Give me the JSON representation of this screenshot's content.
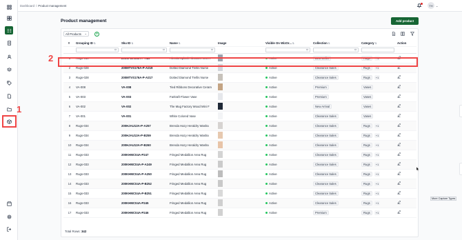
{
  "breadcrumb": {
    "root": "Dashboard",
    "separator": "/",
    "current": "Product management"
  },
  "header": {
    "avatar_initials": "TH",
    "avatar_chevron": "⌄"
  },
  "page": {
    "title": "Product management",
    "add_button": "Add product"
  },
  "toolbar": {
    "filter_value": "All Products",
    "filter_chevron": "⌄",
    "add_view": "+"
  },
  "table": {
    "columns": [
      "#",
      "Grouping ID",
      "Sku ID",
      "Name",
      "Image",
      "Visible On WizOr...",
      "Collection",
      "Category",
      "Action"
    ],
    "sort_glyph": "⇅",
    "filter_glyph": "⛉",
    "rows": [
      {
        "n": "1",
        "group": "Rugs-010",
        "sku": "200CFDRO8A-P-A80",
        "name": "Alessia Splash Abstract Area R",
        "status": "Active",
        "collection": "Best Seller",
        "category": "Rugs",
        "more": "+1",
        "thumb": "#9ca3af"
      },
      {
        "n": "2",
        "group": "Rugs-028",
        "sku": "200MTVS176A-P-A219",
        "name": "Dotted Diamond Trellis Nurse",
        "status": "Active",
        "collection": "Clearance Sales",
        "category": "Rugs",
        "more": "+1",
        "thumb": "#d1d5db"
      },
      {
        "n": "3",
        "group": "Rugs-028",
        "sku": "200MTVS176A-P-A217",
        "name": "Dotted Diamond Trellis Nurse",
        "status": "Active",
        "collection": "Clearance Sales",
        "category": "Rugs",
        "more": "+1",
        "thumb": "#c7c2bb"
      },
      {
        "n": "4",
        "group": "VA-008",
        "sku": "VA-008",
        "name": "Tied Ribbons Decorative Ceram",
        "status": "Active",
        "collection": "Premium",
        "category": "Vases",
        "more": "",
        "thumb": "#c4a484"
      },
      {
        "n": "5",
        "group": "VA-003",
        "sku": "VA-003",
        "name": "Farkraft Flower Vase",
        "status": "Active",
        "collection": "Premium",
        "category": "Vases",
        "more": "",
        "thumb": "#e5e7eb"
      },
      {
        "n": "6",
        "group": "VA-002",
        "sku": "VA-002",
        "name": "The Mug Factory Wood Mini F",
        "status": "Active",
        "collection": "New Arrival",
        "category": "Vases",
        "more": "",
        "thumb": "#1f2937"
      },
      {
        "n": "7",
        "group": "VA-001",
        "sku": "VA-001",
        "name": "White Colored Vase",
        "status": "Active",
        "collection": "Clearance Sales",
        "category": "Vases",
        "more": "",
        "thumb": "#f3f4f6"
      },
      {
        "n": "8",
        "group": "Rugs-034",
        "sku": "200HJAU13A-P-A257",
        "name": "Brenda Hazy Heraldry Washa",
        "status": "Active",
        "collection": "Clearance Sales",
        "category": "Rugs",
        "more": "+1",
        "thumb": "#d6d3d1"
      },
      {
        "n": "9",
        "group": "Rugs-034",
        "sku": "200HJAU13A-P-B259",
        "name": "Brenda Hazy Heraldry Washa",
        "status": "Active",
        "collection": "Clearance Sales",
        "category": "Rugs",
        "more": "+1",
        "thumb": "#e7c9b0"
      },
      {
        "n": "10",
        "group": "Rugs-034",
        "sku": "200HJAU13A-P-B260",
        "name": "Brenda Hazy Heraldry Washa",
        "status": "Active",
        "collection": "Clearance Sales",
        "category": "Rugs",
        "more": "+1",
        "thumb": "#e8c4a8"
      },
      {
        "n": "11",
        "group": "Rugs-033",
        "sku": "200KHMC04A-P247",
        "name": "Fringed Medallion Area Rug",
        "status": "Active",
        "collection": "Clearance Sales",
        "category": "Rugs",
        "more": "+1",
        "thumb": "#d4d4d4"
      },
      {
        "n": "12",
        "group": "Rugs-033",
        "sku": "200KHMC04A-P-A249",
        "name": "Fringed Medallion Area Rug",
        "status": "Active",
        "collection": "Clearance Sales",
        "category": "Rugs",
        "more": "+1",
        "thumb": "#cbcbcb"
      },
      {
        "n": "13",
        "group": "Rugs-033",
        "sku": "200KHMC04A-P-A250",
        "name": "Fringed Medallion Area Rug",
        "status": "Active",
        "collection": "Clearance Sales",
        "category": "Rugs",
        "more": "+1",
        "thumb": "#bdbdbd"
      },
      {
        "n": "14",
        "group": "Rugs-033",
        "sku": "200KHMC04A-P-B252",
        "name": "Fringed Medallion Area Rug",
        "status": "Active",
        "collection": "Clearance Sales",
        "category": "Rugs",
        "more": "+1",
        "thumb": "#c9c9c9"
      },
      {
        "n": "15",
        "group": "Rugs-033",
        "sku": "200KHMC04A-P-B251",
        "name": "Fringed Medallion Area Rug",
        "status": "Active",
        "collection": "Clearance Sales",
        "category": "Rugs",
        "more": "+1",
        "thumb": "#d9d9d9"
      },
      {
        "n": "16",
        "group": "Rugs-033",
        "sku": "200KHMC04A-P245",
        "name": "Fringed Medallion Area Rug",
        "status": "Active",
        "collection": "Clearance Sales",
        "category": "Rugs",
        "more": "+1",
        "thumb": "#cfcfcf"
      },
      {
        "n": "17",
        "group": "Rugs-033",
        "sku": "200KHMC04A-P246",
        "name": "Fringed Medallion Area Rug",
        "status": "Active",
        "collection": "Premium",
        "category": "Rugs",
        "more": "+1",
        "thumb": "#d1d1d1"
      }
    ]
  },
  "footer": {
    "total_label": "Total Rows:",
    "total_value": "342"
  },
  "annotations": {
    "label_1": "1",
    "label_2": "2",
    "color": "#ef4444"
  },
  "tooltip": "More Capture Types",
  "colors": {
    "brand": "#166534",
    "active_dot": "#22c55e"
  }
}
